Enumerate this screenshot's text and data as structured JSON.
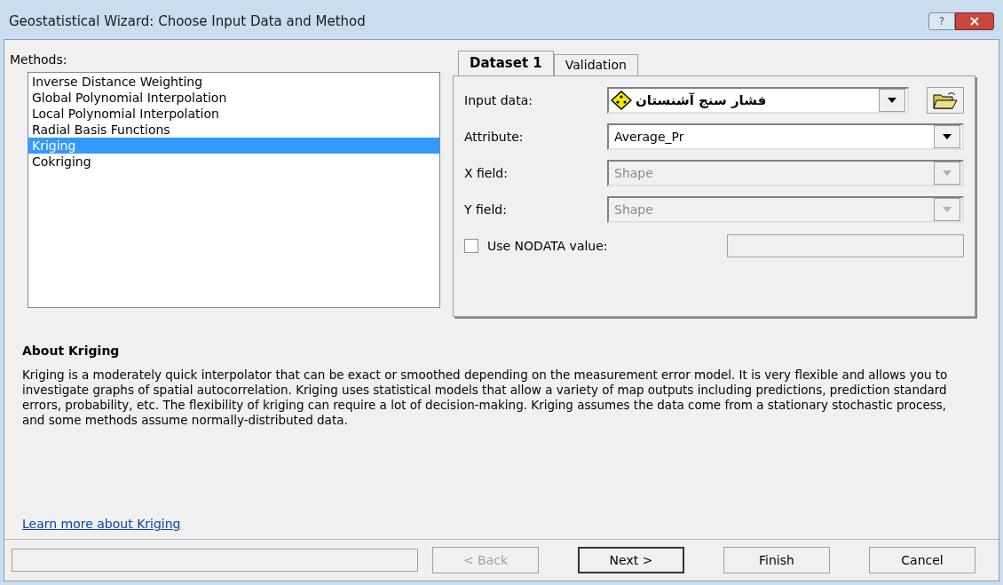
{
  "window": {
    "title": "Geostatistical Wizard: Choose Input Data and Method",
    "help_button": "?",
    "close_button": "×"
  },
  "methods": {
    "label": "Methods:",
    "items": [
      {
        "label": "Inverse Distance Weighting",
        "selected": false
      },
      {
        "label": "Global Polynomial Interpolation",
        "selected": false
      },
      {
        "label": "Local Polynomial Interpolation",
        "selected": false
      },
      {
        "label": "Radial Basis Functions",
        "selected": false
      },
      {
        "label": "Kriging",
        "selected": true
      },
      {
        "label": "Cokriging",
        "selected": false
      }
    ]
  },
  "tabs": [
    {
      "label": "Dataset 1",
      "selected": true
    },
    {
      "label": "Validation",
      "selected": false
    }
  ],
  "fields": [
    {
      "kind": "layer",
      "label": "Input data:",
      "value": "فشار سنج آشنستان",
      "disabled": false
    },
    {
      "kind": "combo",
      "label": "Attribute:",
      "value": "Average_Pr",
      "disabled": false
    },
    {
      "kind": "combo",
      "label": "X field:",
      "value": "Shape",
      "disabled": true
    },
    {
      "kind": "combo",
      "label": "Y field:",
      "value": "Shape",
      "disabled": true
    }
  ],
  "nodata": {
    "label": "Use NODATA value:",
    "checked": false
  },
  "about": {
    "title": "About Kriging",
    "text": "Kriging is a moderately quick interpolator that can be exact or smoothed depending on the measurement error model. It is very flexible and allows you to investigate graphs of spatial autocorrelation. Kriging uses statistical models that allow a variety of map outputs including predictions, prediction standard errors, probability, etc. The flexibility of kriging can require a lot of decision-making. Kriging assumes the data come from a stationary stochastic process, and some methods assume normally-distributed data.",
    "link": "Learn more about Kriging"
  },
  "buttons": [
    {
      "label": "< Back",
      "disabled": true,
      "default": false
    },
    {
      "label": "Next >",
      "disabled": false,
      "default": true
    },
    {
      "label": "Finish",
      "disabled": false,
      "default": false
    },
    {
      "label": "Cancel",
      "disabled": false,
      "default": false
    }
  ]
}
